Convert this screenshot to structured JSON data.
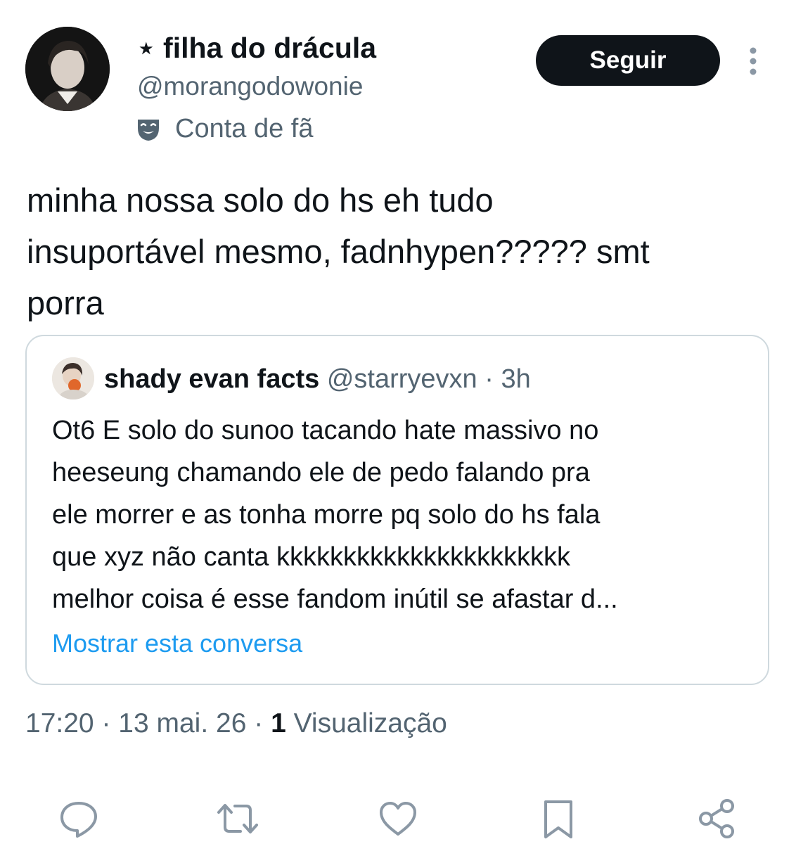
{
  "author": {
    "display_name": "⋆ filha do drácula",
    "handle": "@morangodowonie",
    "fan_label": "Conta de fã",
    "fan_icon": "theater-mask-icon"
  },
  "actions_top": {
    "follow_label": "Seguir",
    "more_icon": "more-vertical-icon"
  },
  "tweet": {
    "text": "minha nossa solo do hs eh tudo\ninsuportável mesmo, fadnhypen????? smt\nporra"
  },
  "quoted": {
    "name": "shady evan facts",
    "handle": "@starryevxn",
    "separator": "·",
    "time": "3h",
    "text": "Ot6 E solo do sunoo tacando hate massivo no\nheeseung chamando ele de pedo falando pra\nele morrer e as tonha morre pq solo do hs fala\nque xyz não canta kkkkkkkkkkkkkkkkkkkkkk\nmelhor coisa é esse fandom inútil se afastar d...",
    "show_thread": "Mostrar esta conversa"
  },
  "meta": {
    "time": "17:20",
    "sep1": " · ",
    "date": "13 mai. 26",
    "sep2": " · ",
    "views_count": "1",
    "views_label": " Visualização"
  },
  "action_bar": [
    "reply-icon",
    "retweet-icon",
    "like-icon",
    "bookmark-icon",
    "share-icon"
  ],
  "colors": {
    "text": "#0f1419",
    "secondary": "#536471",
    "link": "#1d9bf0",
    "border": "#cfd9de",
    "button_bg": "#0f1419"
  }
}
